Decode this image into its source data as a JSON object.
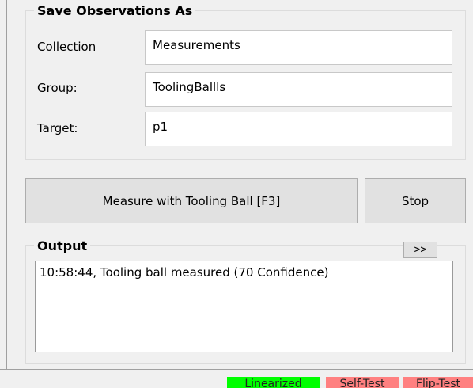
{
  "save_group": {
    "title": "Save Observations As",
    "fields": [
      {
        "label": "Collection",
        "value": "Measurements"
      },
      {
        "label": "Group:",
        "value": "ToolingBallls"
      },
      {
        "label": "Target:",
        "value": "p1"
      }
    ]
  },
  "actions": {
    "measure_label": "Measure with Tooling Ball [F3]",
    "stop_label": "Stop"
  },
  "output": {
    "title": "Output",
    "expand_label": ">>",
    "lines": [
      "10:58:44, Tooling ball measured (70 Confidence)"
    ]
  },
  "status": {
    "items": [
      {
        "label": "Linearized",
        "color": "#00ff00"
      },
      {
        "label": "Self-Test",
        "color": "#ff8080"
      },
      {
        "label": "Flip-Test",
        "color": "#ff8080"
      }
    ]
  }
}
